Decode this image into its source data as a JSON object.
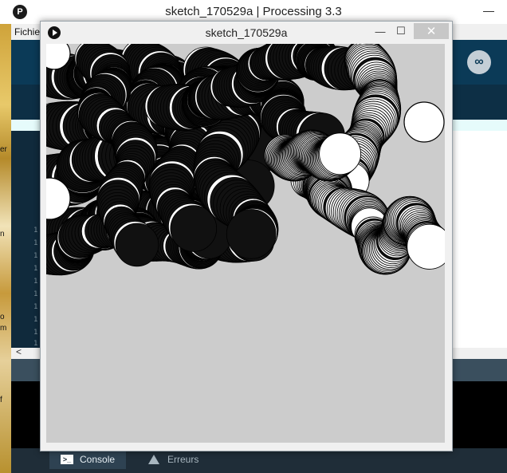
{
  "ide": {
    "title": "sketch_170529a | Processing 3.3",
    "minimize_glyph": "—",
    "menu_first": "Fichie",
    "mode_icon": "infinity-icon",
    "scroll_left_glyph": "<",
    "line_number_glyph": "1",
    "left_strip_fragments": [
      "er",
      "n",
      "o",
      "m",
      "f"
    ]
  },
  "sketch_window": {
    "title": "sketch_170529a",
    "minimize_glyph": "—",
    "maximize_glyph": "☐",
    "close_glyph": "✕"
  },
  "footer": {
    "console_label": "Console",
    "errors_label": "Erreurs"
  },
  "colors": {
    "canvas_bg": "#cccccc",
    "stroke": "#000000",
    "ide_toolbar": "#0b3a57",
    "footer_bg": "#1f2d38"
  }
}
